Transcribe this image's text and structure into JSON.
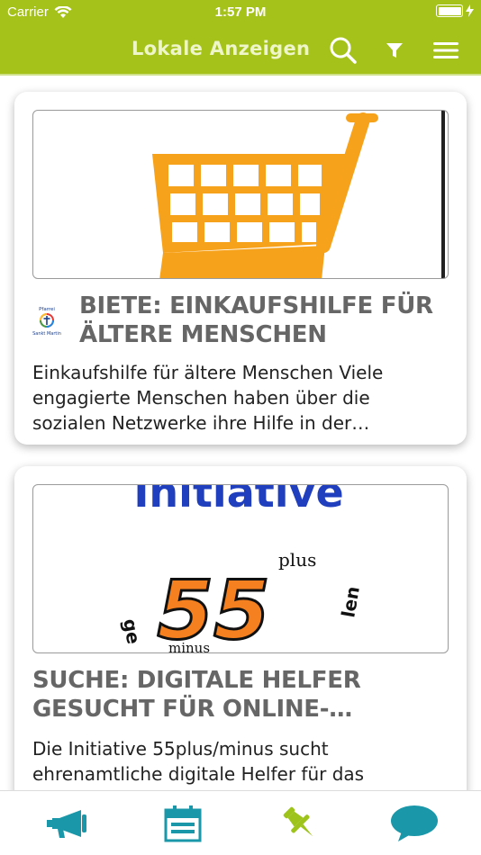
{
  "status_bar": {
    "carrier": "Carrier",
    "time": "1:57 PM"
  },
  "nav": {
    "title": "Lokale Anzeigen",
    "icons": [
      "search-icon",
      "filter-icon",
      "menu-icon"
    ]
  },
  "colors": {
    "brand_green": "#a5c21b",
    "accent_teal": "#1a97a8",
    "pin_green": "#9ec41c",
    "cart_orange": "#f7a21b"
  },
  "cards": [
    {
      "image": "shopping-cart",
      "logo_text": [
        "Pfarrei",
        "Sankt Martin"
      ],
      "title": "BIETE: EINKAUFSHILFE FÜR ÄLTERE MENSCHEN",
      "title_lines": [
        "BIETE: EINKAUFSHILFE FÜR",
        "ÄLTERE MENSCHEN"
      ],
      "text_lines": [
        "Einkaufshilfe für ältere Menschen Viele",
        "engagierte Menschen haben über die",
        "sozialen Netzwerke ihre Hilfe in der…"
      ]
    },
    {
      "image": "initiative-55plus",
      "image_text": {
        "heading": "Initiative",
        "number": "55",
        "plus": "plus",
        "minus": "minus",
        "left_word": "ge",
        "right_word": "len"
      },
      "title_lines": [
        "SUCHE: DIGITALE HELFER",
        "GESUCHT FÜR ONLINE-…"
      ],
      "text_lines": [
        "Die Initiative 55plus/minus sucht",
        "ehrenamtliche digitale Helfer für das"
      ]
    }
  ],
  "tabs": [
    "megaphone-icon",
    "calendar-icon",
    "pin-icon",
    "chat-icon"
  ]
}
